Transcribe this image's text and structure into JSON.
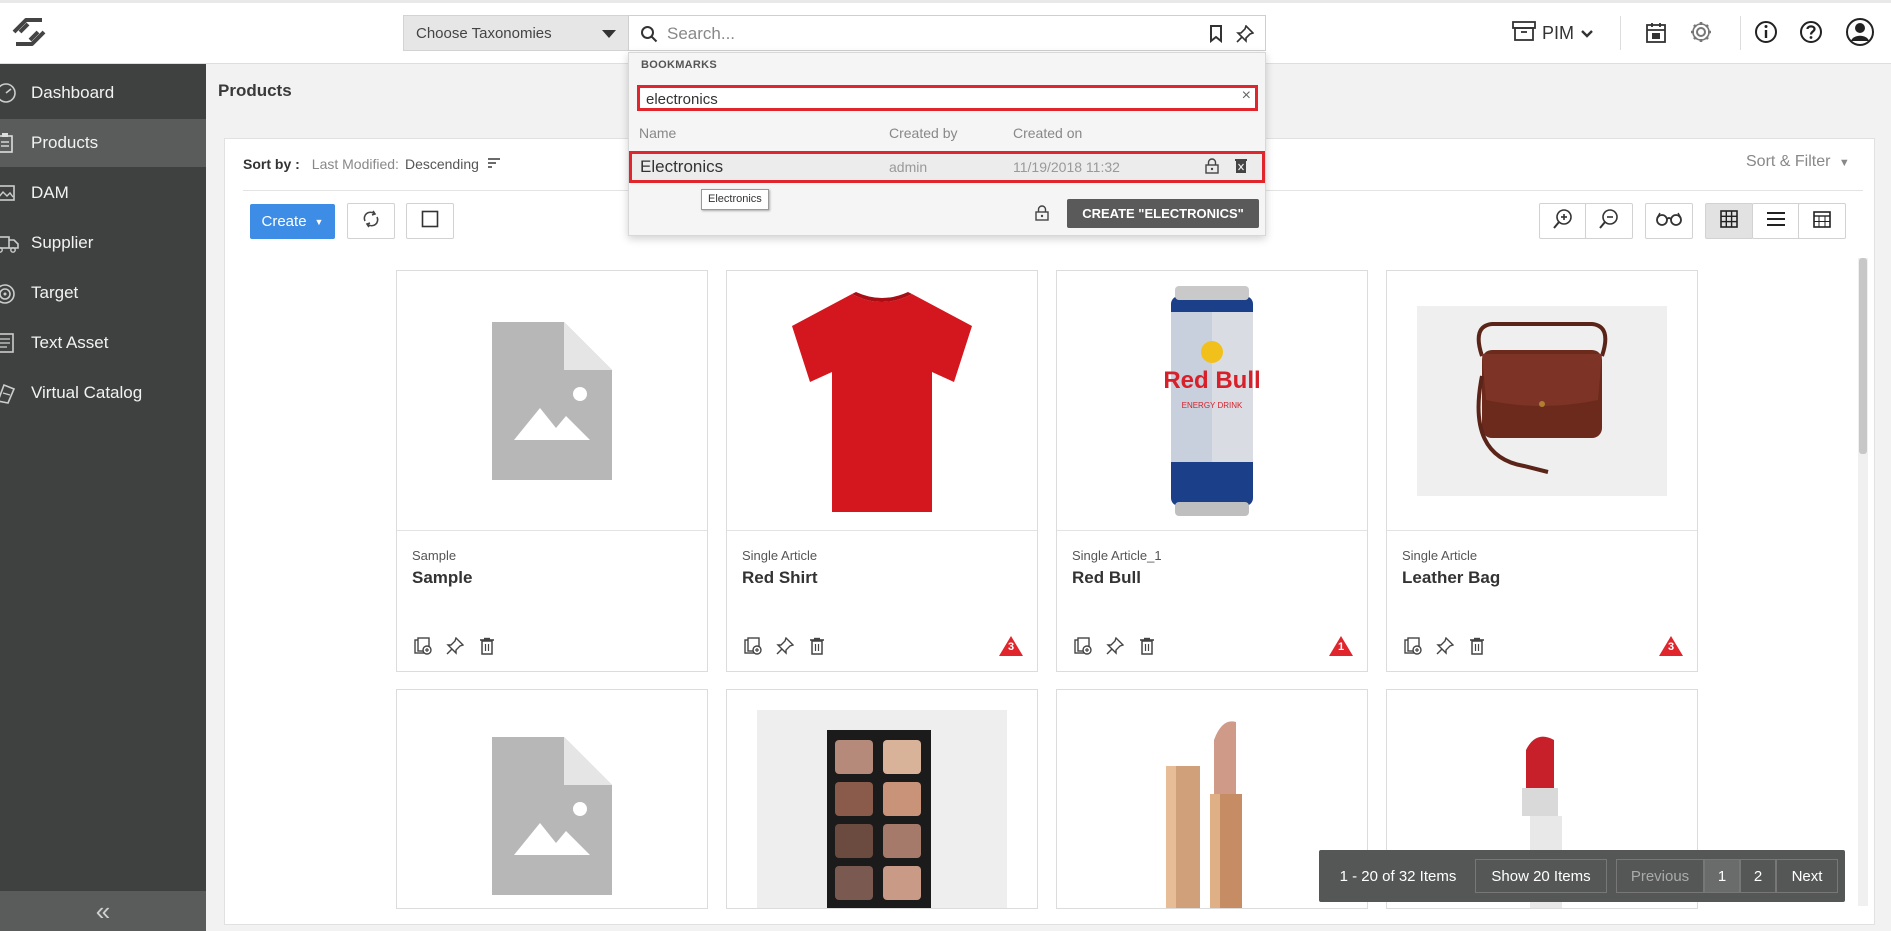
{
  "topbar": {
    "taxonomy_label": "Choose Taxonomies",
    "search_placeholder": "Search...",
    "workspace_label": "PIM"
  },
  "sidebar": {
    "items": [
      {
        "label": "Dashboard",
        "icon": "dashboard-icon"
      },
      {
        "label": "Products",
        "icon": "products-icon",
        "active": true
      },
      {
        "label": "DAM",
        "icon": "image-icon"
      },
      {
        "label": "Supplier",
        "icon": "truck-icon"
      },
      {
        "label": "Target",
        "icon": "target-icon"
      },
      {
        "label": "Text Asset",
        "icon": "text-asset-icon"
      },
      {
        "label": "Virtual Catalog",
        "icon": "catalog-icon"
      }
    ],
    "collapse_label": "«"
  },
  "main": {
    "title": "Products",
    "sort_label": "Sort by :",
    "sort_field": "Last Modified:",
    "sort_order": "Descending",
    "sort_filter_label": "Sort & Filter",
    "create_label": "Create"
  },
  "bookmarks": {
    "heading": "BOOKMARKS",
    "filter_value": "electronics",
    "columns": {
      "name": "Name",
      "created_by": "Created by",
      "created_on": "Created on"
    },
    "rows": [
      {
        "name": "Electronics",
        "created_by": "admin",
        "created_on": "11/19/2018 11:32"
      }
    ],
    "tooltip": "Electronics",
    "create_label": "CREATE \"ELECTRONICS\""
  },
  "products": [
    {
      "type": "Sample",
      "name": "Sample",
      "image": "placeholder",
      "warnings": null
    },
    {
      "type": "Single Article",
      "name": "Red Shirt",
      "image": "red-shirt",
      "warnings": "3"
    },
    {
      "type": "Single Article_1",
      "name": "Red Bull",
      "image": "red-bull-can",
      "warnings": "1"
    },
    {
      "type": "Single Article",
      "name": "Leather Bag",
      "image": "leather-bag",
      "warnings": "3"
    },
    {
      "type": "",
      "name": "",
      "image": "placeholder",
      "warnings": null
    },
    {
      "type": "",
      "name": "",
      "image": "eyeshadow-palette",
      "warnings": null
    },
    {
      "type": "",
      "name": "",
      "image": "lipstick-nude",
      "warnings": null
    },
    {
      "type": "",
      "name": "",
      "image": "lipstick-red",
      "warnings": null
    }
  ],
  "pagination": {
    "summary": "1 - 20 of 32 Items",
    "page_size": "Show 20 Items",
    "previous": "Previous",
    "pages": [
      "1",
      "2"
    ],
    "next": "Next"
  },
  "colors": {
    "primary_button": "#3d8ce6",
    "sidebar": "#3f4141",
    "highlight_border": "#e0252d",
    "warning": "#e0252d"
  }
}
